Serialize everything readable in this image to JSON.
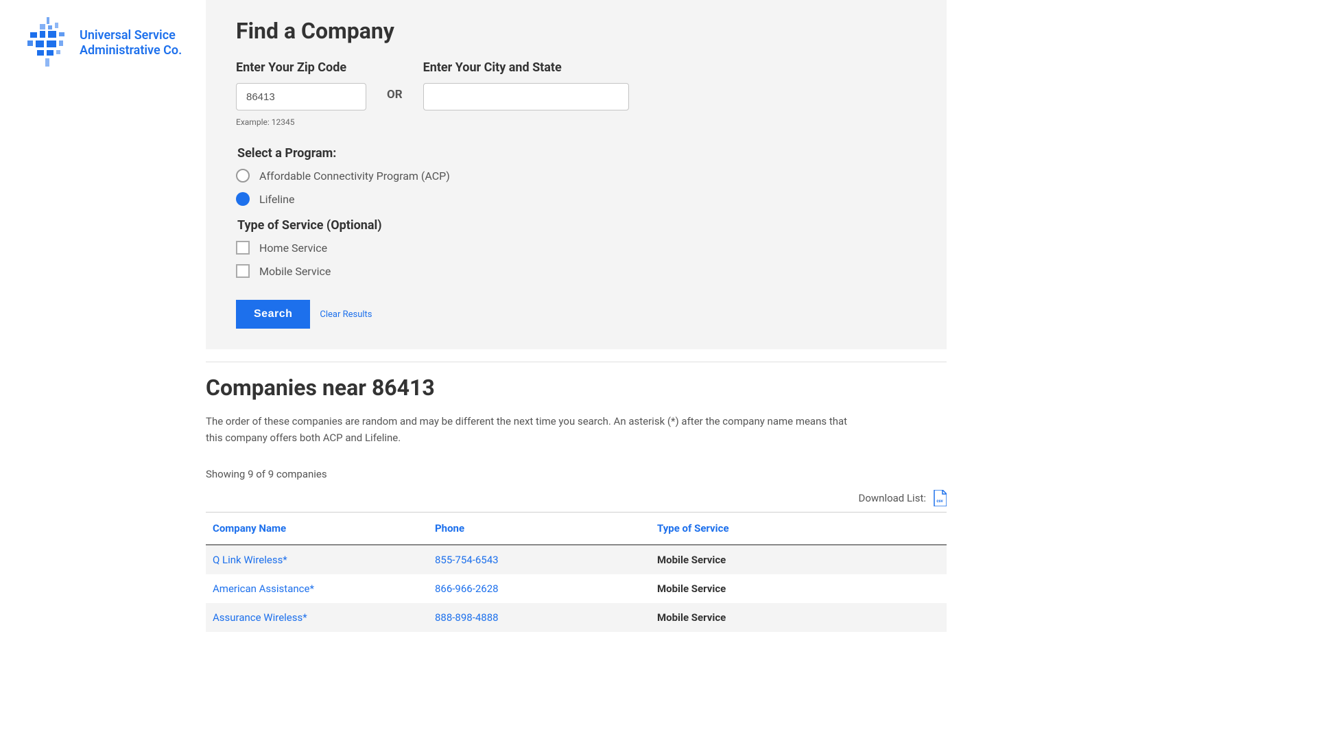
{
  "logo": {
    "line1": "Universal Service",
    "line2": "Administrative Co."
  },
  "search": {
    "title": "Find a Company",
    "zip_label": "Enter Your Zip Code",
    "zip_value": "86413",
    "zip_hint": "Example: 12345",
    "or_label": "OR",
    "city_label": "Enter Your City and State",
    "city_value": "",
    "program_label": "Select a Program:",
    "program_options": [
      {
        "label": "Affordable Connectivity Program (ACP)",
        "selected": false
      },
      {
        "label": "Lifeline",
        "selected": true
      }
    ],
    "service_label": "Type of Service (Optional)",
    "service_options": [
      {
        "label": "Home Service",
        "checked": false
      },
      {
        "label": "Mobile Service",
        "checked": false
      }
    ],
    "search_btn": "Search",
    "clear_link": "Clear Results"
  },
  "results": {
    "title": "Companies near 86413",
    "note": "The order of these companies are random and may be different the next time you search. An asterisk (*) after the company name means that this company offers both ACP and Lifeline.",
    "count": "Showing 9 of 9 companies",
    "download_label": "Download List:",
    "csv_label": "csv",
    "headers": {
      "company": "Company Name",
      "phone": "Phone",
      "service": "Type of Service"
    },
    "rows": [
      {
        "company": "Q Link Wireless*",
        "phone": "855-754-6543",
        "service": "Mobile Service"
      },
      {
        "company": "American Assistance*",
        "phone": "866-966-2628",
        "service": "Mobile Service"
      },
      {
        "company": "Assurance Wireless*",
        "phone": "888-898-4888",
        "service": "Mobile Service"
      }
    ]
  }
}
